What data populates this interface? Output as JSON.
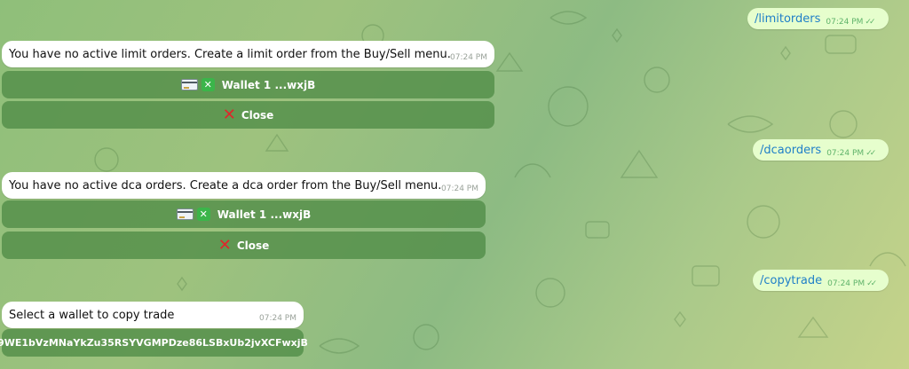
{
  "messages_out": [
    {
      "command": "/limitorders",
      "time": "07:24 PM",
      "status_icon": "double-check-icon"
    },
    {
      "command": "/dcaorders",
      "time": "07:24 PM",
      "status_icon": "double-check-icon"
    },
    {
      "command": "/copytrade",
      "time": "07:24 PM",
      "status_icon": "double-check-icon"
    }
  ],
  "messages_in": [
    {
      "text": "You have no active limit orders. Create a limit order from the Buy/Sell menu.",
      "time": "07:24 PM",
      "buttons": [
        {
          "label": "Wallet 1 ...wxjB",
          "icons": [
            "credit-card-icon",
            "green-cross-mark-icon"
          ]
        },
        {
          "label": "Close",
          "icons": [
            "red-cross-icon"
          ]
        }
      ]
    },
    {
      "text": "You have no active dca orders. Create a dca order from the Buy/Sell menu.",
      "time": "07:24 PM",
      "buttons": [
        {
          "label": "Wallet 1 ...wxjB",
          "icons": [
            "credit-card-icon",
            "green-cross-mark-icon"
          ]
        },
        {
          "label": "Close",
          "icons": [
            "red-cross-icon"
          ]
        }
      ]
    },
    {
      "text": "Select a wallet to copy trade",
      "time": "07:24 PM",
      "buttons": [
        {
          "label": "9WE1bVzMNaYkZu35RSYVGMPDze86LSBxUb2jvXCFwxjB",
          "icons": []
        }
      ]
    }
  ],
  "colors": {
    "background_start": "#8fbf7a",
    "background_end": "#c6d38a",
    "outgoing_bubble": "#e6fecd",
    "command_link": "#1f7fc8",
    "incoming_bubble": "#ffffff",
    "keyboard_button": "#508c46",
    "read_check": "#5fb36a"
  }
}
